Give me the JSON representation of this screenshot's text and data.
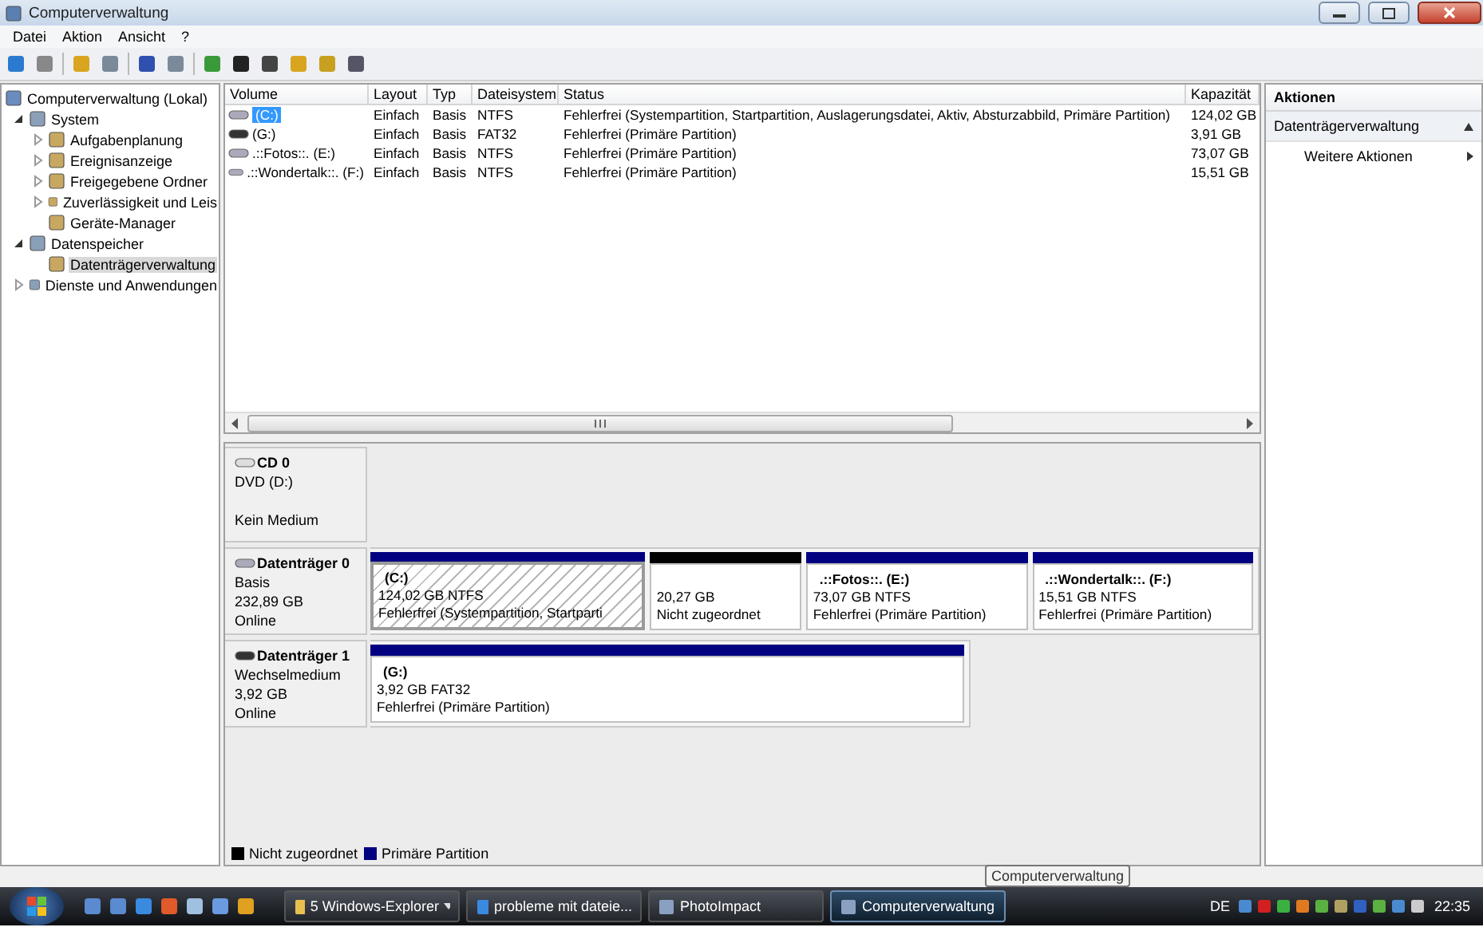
{
  "window": {
    "title": "Computerverwaltung"
  },
  "menu": [
    "Datei",
    "Aktion",
    "Ansicht",
    "?"
  ],
  "tree": [
    {
      "label": "Computerverwaltung (Lokal)",
      "selected": false,
      "children": [
        {
          "label": "System",
          "expanded": true,
          "selected": false,
          "children": [
            {
              "label": "Aufgabenplanung",
              "expanded": false,
              "selected": false
            },
            {
              "label": "Ereignisanzeige",
              "expanded": false,
              "selected": false
            },
            {
              "label": "Freigegebene Ordner",
              "expanded": false,
              "selected": false
            },
            {
              "label": "Zuverlässigkeit und Leis",
              "expanded": false,
              "selected": false
            },
            {
              "label": "Geräte-Manager",
              "selected": false
            }
          ]
        },
        {
          "label": "Datenspeicher",
          "expanded": true,
          "selected": false,
          "children": [
            {
              "label": "Datenträgerverwaltung",
              "selected": true
            }
          ]
        },
        {
          "label": "Dienste und Anwendungen",
          "expanded": false,
          "selected": false
        }
      ]
    }
  ],
  "volume_table": {
    "columns": [
      "Volume",
      "Layout",
      "Typ",
      "Dateisystem",
      "Status",
      "Kapazität"
    ],
    "rows": [
      {
        "kind": "fixed",
        "selected": true,
        "cells": [
          "(C:)",
          "Einfach",
          "Basis",
          "NTFS",
          "Fehlerfrei (Systempartition, Startpartition, Auslagerungsdatei, Aktiv, Absturzabbild, Primäre Partition)",
          "124,02 GB"
        ]
      },
      {
        "kind": "removable",
        "selected": false,
        "cells": [
          "(G:)",
          "Einfach",
          "Basis",
          "FAT32",
          "Fehlerfrei (Primäre Partition)",
          "3,91 GB"
        ]
      },
      {
        "kind": "fixed",
        "selected": false,
        "cells": [
          ".::Fotos::. (E:)",
          "Einfach",
          "Basis",
          "NTFS",
          "Fehlerfrei (Primäre Partition)",
          "73,07 GB"
        ]
      },
      {
        "kind": "fixed",
        "selected": false,
        "cells": [
          ".::Wondertalk::. (F:)",
          "Einfach",
          "Basis",
          "NTFS",
          "Fehlerfrei (Primäre Partition)",
          "15,51 GB"
        ]
      }
    ]
  },
  "disks": [
    {
      "kind": "cd",
      "name": "CD 0",
      "type": "DVD (D:)",
      "status": "Kein Medium"
    },
    {
      "kind": "disk",
      "name": "Datenträger 0",
      "type": "Basis",
      "size": "232,89 GB",
      "status": "Online",
      "partitions": [
        {
          "kind": "primary",
          "selected": true,
          "label": "(C:)",
          "detail": "124,02 GB NTFS",
          "status": "Fehlerfrei (Systempartition, Startparti"
        },
        {
          "kind": "unallocated",
          "selected": false,
          "detail": "20,27 GB",
          "status": "Nicht zugeordnet"
        },
        {
          "kind": "primary",
          "selected": false,
          "label": ".::Fotos::.  (E:)",
          "detail": "73,07 GB NTFS",
          "status": "Fehlerfrei (Primäre Partition)"
        },
        {
          "kind": "primary",
          "selected": false,
          "label": ".::Wondertalk::.  (F:)",
          "detail": "15,51 GB NTFS",
          "status": "Fehlerfrei (Primäre Partition)"
        }
      ]
    },
    {
      "kind": "removable",
      "name": "Datenträger 1",
      "type": "Wechselmedium",
      "size": "3,92 GB",
      "status": "Online",
      "partitions": [
        {
          "kind": "primary",
          "selected": false,
          "label": "(G:)",
          "detail": "3,92 GB FAT32",
          "status": "Fehlerfrei (Primäre Partition)"
        }
      ]
    }
  ],
  "legend": [
    {
      "label": "Nicht zugeordnet",
      "color": "#000000"
    },
    {
      "label": "Primäre Partition",
      "color": "#000080"
    }
  ],
  "actions": {
    "title": "Aktionen",
    "section": {
      "label": "Datenträgerverwaltung",
      "expanded": true
    },
    "items": [
      "Weitere Aktionen"
    ]
  },
  "taskbar": {
    "tasks": [
      {
        "kind": "group",
        "label": "5 Windows-Explorer",
        "selected": false
      },
      {
        "kind": "browser",
        "label": "probleme mit dateie...",
        "selected": false
      },
      {
        "kind": "app",
        "label": "PhotoImpact",
        "selected": false
      },
      {
        "kind": "app",
        "label": "Computerverwaltung",
        "selected": true
      }
    ],
    "language": "DE",
    "clock": "22:35",
    "tooltip": "Computerverwaltung"
  }
}
